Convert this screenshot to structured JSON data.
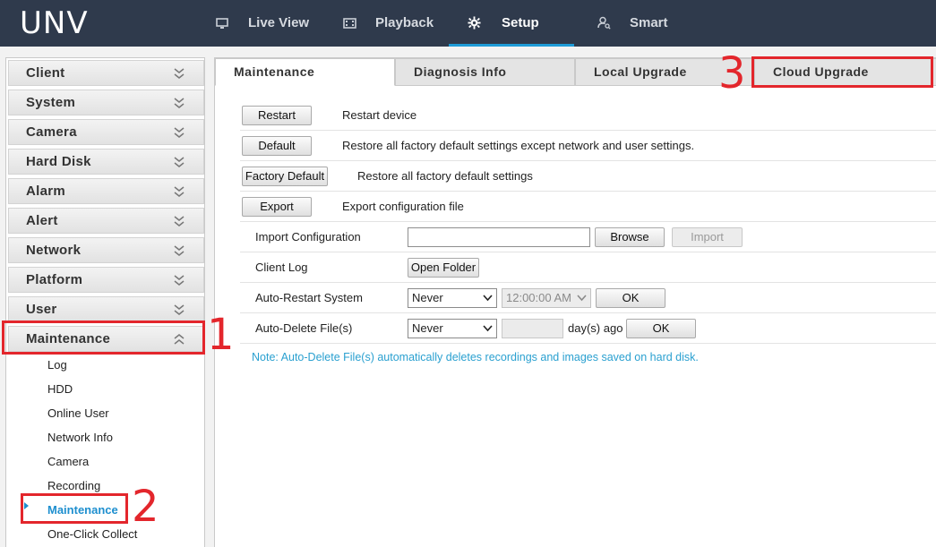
{
  "header": {
    "logo": "UNV",
    "nav": [
      {
        "label": "Live View",
        "icon": "monitor-icon",
        "active": false
      },
      {
        "label": "Playback",
        "icon": "film-icon",
        "active": false
      },
      {
        "label": "Setup",
        "icon": "gear-icon",
        "active": true
      },
      {
        "label": "Smart",
        "icon": "user-search-icon",
        "active": false
      }
    ]
  },
  "sidebar": {
    "groups": [
      {
        "label": "Client",
        "expanded": false
      },
      {
        "label": "System",
        "expanded": false
      },
      {
        "label": "Camera",
        "expanded": false
      },
      {
        "label": "Hard Disk",
        "expanded": false
      },
      {
        "label": "Alarm",
        "expanded": false
      },
      {
        "label": "Alert",
        "expanded": false
      },
      {
        "label": "Network",
        "expanded": false
      },
      {
        "label": "Platform",
        "expanded": false
      },
      {
        "label": "User",
        "expanded": false
      },
      {
        "label": "Maintenance",
        "expanded": true
      }
    ],
    "sub_items": [
      {
        "label": "Log",
        "active": false
      },
      {
        "label": "HDD",
        "active": false
      },
      {
        "label": "Online User",
        "active": false
      },
      {
        "label": "Network Info",
        "active": false
      },
      {
        "label": "Camera",
        "active": false
      },
      {
        "label": "Recording",
        "active": false
      },
      {
        "label": "Maintenance",
        "active": true
      },
      {
        "label": "One-Click Collect",
        "active": false
      }
    ]
  },
  "tabs": [
    {
      "label": "Maintenance",
      "active": true
    },
    {
      "label": "Diagnosis Info",
      "active": false
    },
    {
      "label": "Local Upgrade",
      "active": false
    },
    {
      "label": "Cloud Upgrade",
      "active": false
    }
  ],
  "maintenance": {
    "restart": {
      "button": "Restart",
      "desc": "Restart device"
    },
    "default": {
      "button": "Default",
      "desc": "Restore all factory default settings except network and user settings."
    },
    "factory_default": {
      "button": "Factory Default",
      "desc": "Restore all factory default settings"
    },
    "export": {
      "button": "Export",
      "desc": "Export configuration file"
    },
    "import": {
      "label": "Import Configuration",
      "value": "",
      "browse": "Browse",
      "import": "Import"
    },
    "client_log": {
      "label": "Client Log",
      "button": "Open Folder"
    },
    "auto_restart": {
      "label": "Auto-Restart System",
      "select": "Never",
      "time": "12:00:00 AM",
      "ok": "OK"
    },
    "auto_delete": {
      "label": "Auto-Delete File(s)",
      "select": "Never",
      "days": "",
      "suffix": "day(s) ago",
      "ok": "OK"
    },
    "note": "Note: Auto-Delete File(s) automatically deletes recordings and images saved on hard disk."
  },
  "annotations": {
    "step1": "1",
    "step2": "2",
    "step3": "3",
    "color": "#e3262c"
  },
  "colors": {
    "header_bg": "#2f3a4c",
    "accent": "#1e9bd7",
    "note": "#2aa0d0"
  }
}
